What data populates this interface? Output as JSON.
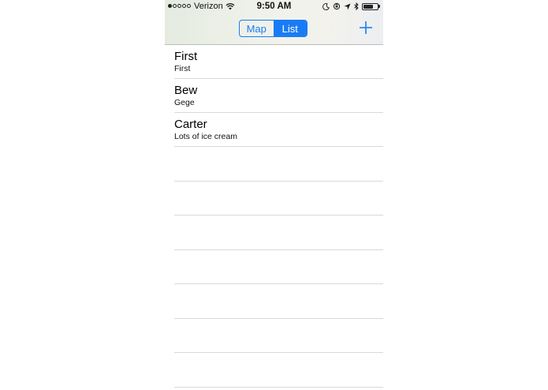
{
  "status_bar": {
    "carrier": "Verizon",
    "time": "9:50 AM",
    "signal_bars_filled": 1,
    "signal_bars_total": 5,
    "battery_level": 0.72
  },
  "nav": {
    "segments": [
      {
        "label": "Map",
        "selected": false
      },
      {
        "label": "List",
        "selected": true
      }
    ],
    "add_icon": "plus-icon"
  },
  "colors": {
    "accent": "#1a7cf5",
    "separator": "#d9d9dd"
  },
  "list": {
    "items": [
      {
        "title": "First",
        "subtitle": "First"
      },
      {
        "title": "Bew",
        "subtitle": "Gege"
      },
      {
        "title": "Carter",
        "subtitle": "Lots of ice cream"
      }
    ]
  }
}
